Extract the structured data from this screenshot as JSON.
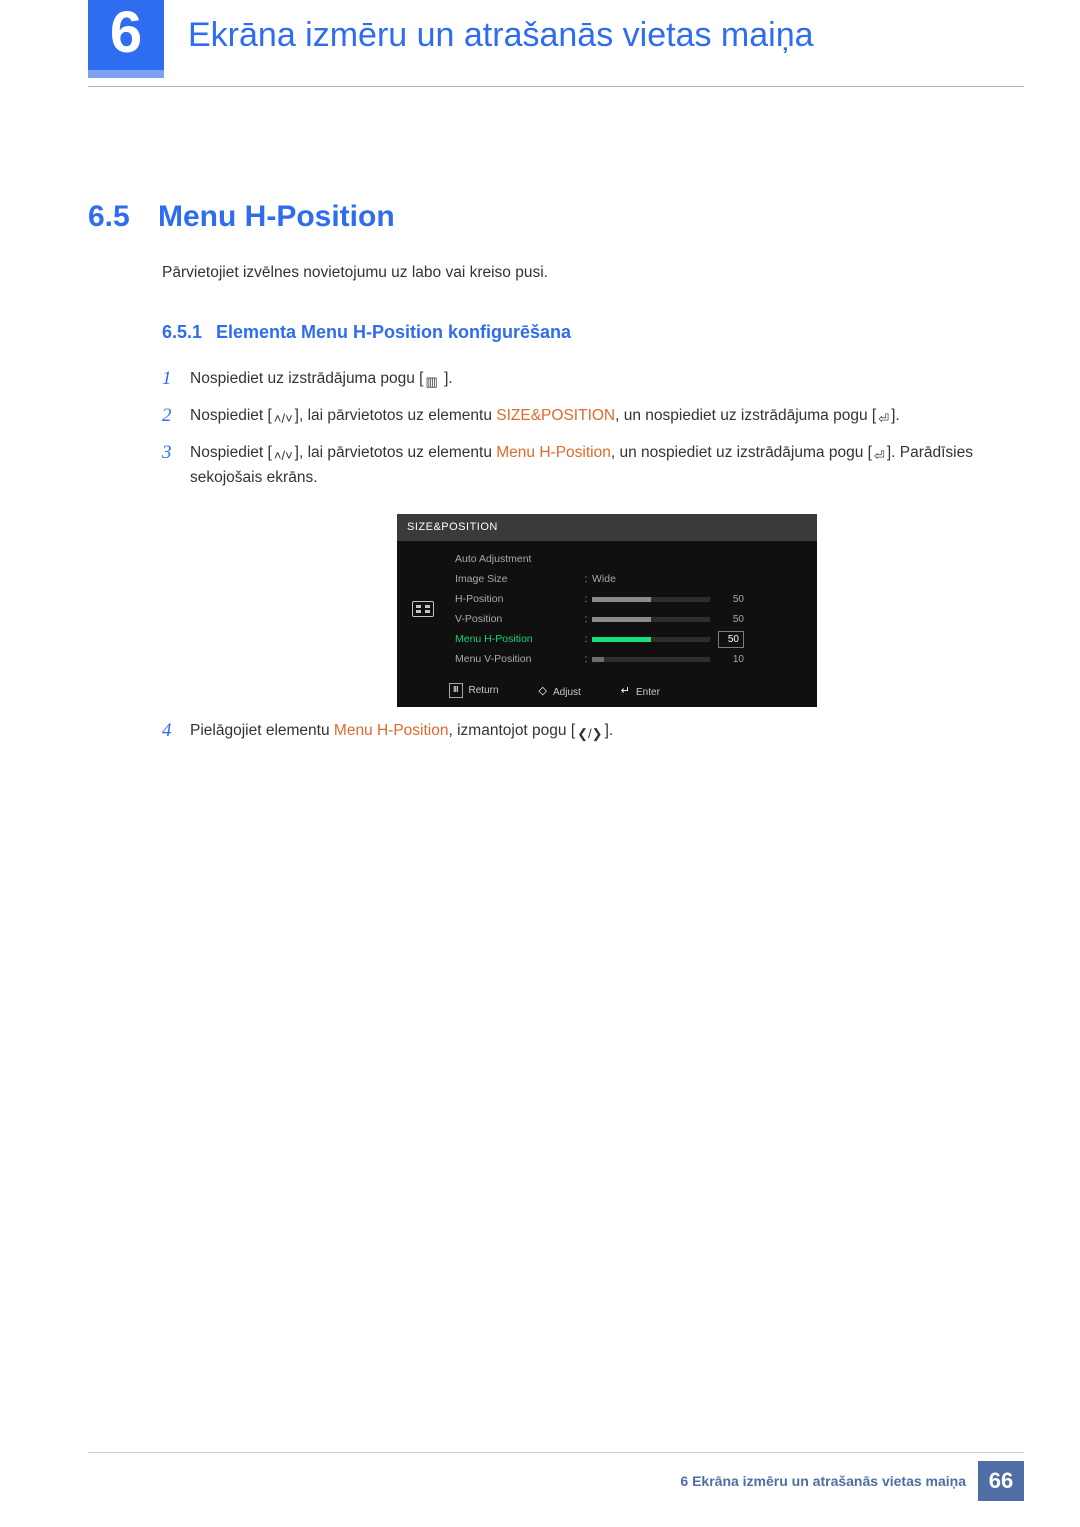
{
  "header": {
    "chapter_num": "6",
    "chapter_title": "Ekrāna izmēru un atrašanās vietas maiņa"
  },
  "section": {
    "num": "6.5",
    "title": "Menu H-Position",
    "intro": "Pārvietojiet izvēlnes novietojumu uz labo vai kreiso pusi."
  },
  "subsection": {
    "num": "6.5.1",
    "title": "Elementa Menu H-Position konfigurēšana"
  },
  "steps": {
    "s1": {
      "n": "1",
      "a": "Nospiediet uz izstrādājuma pogu [",
      "b": " ]."
    },
    "s2": {
      "n": "2",
      "a": "Nospiediet [",
      "b": "], lai pārvietotos uz elementu ",
      "hl": "SIZE&POSITION",
      "c": ", un nospiediet uz izstrādājuma pogu [",
      "d": "]."
    },
    "s3": {
      "n": "3",
      "a": "Nospiediet [",
      "b": "], lai pārvietotos uz elementu ",
      "hl": "Menu H-Position",
      "c": ", un nospiediet uz izstrādājuma pogu [",
      "d": "]. Parādīsies sekojošais ekrāns."
    },
    "s4": {
      "n": "4",
      "a": "Pielāgojiet elementu ",
      "hl": "Menu H-Position",
      "b": ", izmantojot pogu [",
      "c": "]."
    }
  },
  "osd": {
    "title": "SIZE&POSITION",
    "rows": {
      "auto": {
        "label": "Auto Adjustment",
        "value": ""
      },
      "size": {
        "label": "Image Size",
        "value": "Wide"
      },
      "hp": {
        "label": "H-Position",
        "num": "50",
        "pct": 50
      },
      "vp": {
        "label": "V-Position",
        "num": "50",
        "pct": 50
      },
      "mhp": {
        "label": "Menu H-Position",
        "num": "50",
        "pct": 50
      },
      "mvp": {
        "label": "Menu V-Position",
        "num": "10",
        "pct": 10
      }
    },
    "foot": {
      "return": "Return",
      "adjust": "Adjust",
      "enter": "Enter"
    }
  },
  "footer": {
    "text": "6 Ekrāna izmēru un atrašanās vietas maiņa",
    "page": "66"
  },
  "glyphs": {
    "menu": "▥",
    "updown": "˄/˅",
    "enter": "⏎",
    "leftright": "❮/❯"
  }
}
